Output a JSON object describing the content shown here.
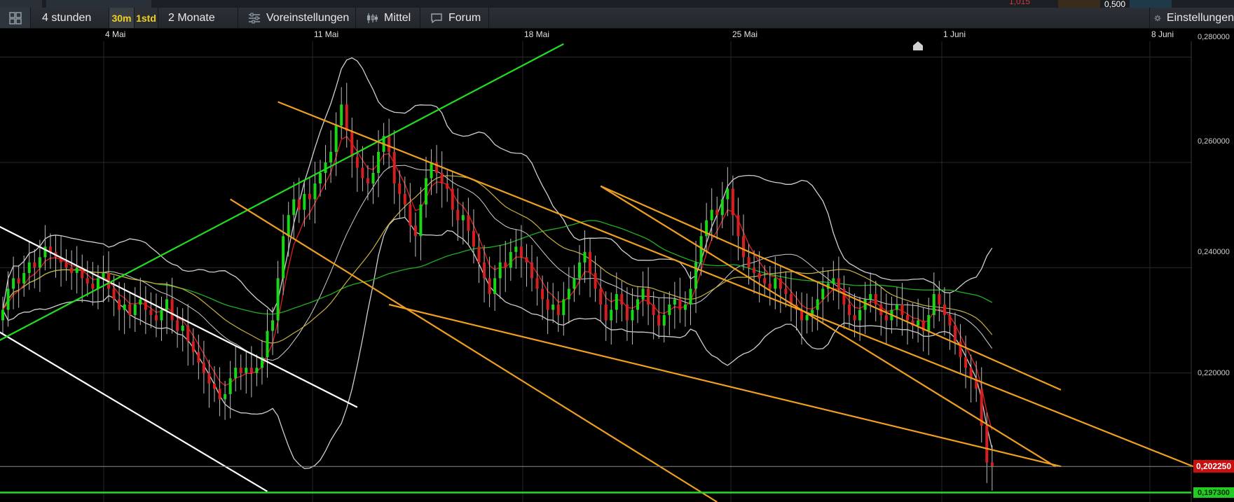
{
  "topbar": {
    "value_red": "1,015",
    "value_white": "0,500"
  },
  "toolbar": {
    "period_label": "4 stunden",
    "interval_30m": "30m",
    "interval_1std": "1std",
    "range_label": "2 Monate",
    "presets_label": "Voreinstellungen",
    "indicator_label": "Mittel",
    "forum_label": "Forum",
    "settings_label": "Einstellungen"
  },
  "xaxis": {
    "labels": [
      {
        "text": "4 Mai"
      },
      {
        "text": "11 Mai"
      },
      {
        "text": "18 Mai"
      },
      {
        "text": "25 Mai"
      },
      {
        "text": "1 Juni"
      },
      {
        "text": "8 Juni"
      }
    ]
  },
  "yaxis": {
    "labels": [
      "0,280000",
      "0,260000",
      "0,240000",
      "0,220000"
    ]
  },
  "price_tags": {
    "current": "0,202250",
    "support": "0,197300"
  },
  "colors": {
    "bull": "#19d619",
    "bear": "#d42020",
    "ema_fast": "#e02020",
    "sma_mid": "#c8b040",
    "sma_slow": "#20b020",
    "bands": "#cfcfcf",
    "channel_orange": "#f0a020",
    "channel_white": "#ffffff",
    "trend_green": "#22dd22",
    "current_tag_bg": "#c81010",
    "support_tag_bg": "#22cc22"
  },
  "chart_data": {
    "type": "candlestick",
    "title": "",
    "xlabel": "",
    "ylabel": "",
    "ylim": [
      0.1955,
      0.283
    ],
    "interval": "4 stunden",
    "current_price": 0.20225,
    "support_level": 0.1973,
    "series_close": [
      0.232,
      0.236,
      0.238,
      0.237,
      0.239,
      0.241,
      0.24,
      0.242,
      0.244,
      0.243,
      0.242,
      0.241,
      0.24,
      0.239,
      0.24,
      0.238,
      0.237,
      0.236,
      0.238,
      0.239,
      0.236,
      0.234,
      0.232,
      0.233,
      0.231,
      0.233,
      0.234,
      0.232,
      0.231,
      0.23,
      0.232,
      0.234,
      0.23,
      0.228,
      0.229,
      0.226,
      0.224,
      0.222,
      0.22,
      0.218,
      0.217,
      0.215,
      0.216,
      0.219,
      0.221,
      0.22,
      0.221,
      0.22,
      0.221,
      0.223,
      0.228,
      0.23,
      0.238,
      0.246,
      0.25,
      0.253,
      0.251,
      0.254,
      0.253,
      0.256,
      0.258,
      0.26,
      0.262,
      0.267,
      0.271,
      0.266,
      0.261,
      0.259,
      0.257,
      0.256,
      0.258,
      0.262,
      0.265,
      0.262,
      0.256,
      0.254,
      0.252,
      0.248,
      0.246,
      0.252,
      0.257,
      0.26,
      0.258,
      0.256,
      0.255,
      0.251,
      0.249,
      0.25,
      0.247,
      0.244,
      0.241,
      0.238,
      0.235,
      0.238,
      0.241,
      0.24,
      0.243,
      0.244,
      0.242,
      0.241,
      0.238,
      0.236,
      0.234,
      0.232,
      0.233,
      0.231,
      0.234,
      0.236,
      0.238,
      0.241,
      0.243,
      0.239,
      0.236,
      0.233,
      0.23,
      0.232,
      0.235,
      0.233,
      0.23,
      0.232,
      0.234,
      0.236,
      0.233,
      0.231,
      0.229,
      0.231,
      0.233,
      0.234,
      0.232,
      0.233,
      0.236,
      0.241,
      0.246,
      0.249,
      0.251,
      0.25,
      0.253,
      0.255,
      0.25,
      0.246,
      0.242,
      0.24,
      0.239,
      0.238,
      0.237,
      0.236,
      0.238,
      0.236,
      0.235,
      0.233,
      0.232,
      0.23,
      0.231,
      0.232,
      0.234,
      0.236,
      0.237,
      0.238,
      0.236,
      0.233,
      0.231,
      0.23,
      0.232,
      0.234,
      0.235,
      0.233,
      0.231,
      0.23,
      0.232,
      0.233,
      0.231,
      0.23,
      0.229,
      0.23,
      0.228,
      0.231,
      0.235,
      0.233,
      0.231,
      0.229,
      0.226,
      0.223,
      0.221,
      0.219,
      0.217,
      0.21,
      0.203,
      0.20225
    ]
  }
}
